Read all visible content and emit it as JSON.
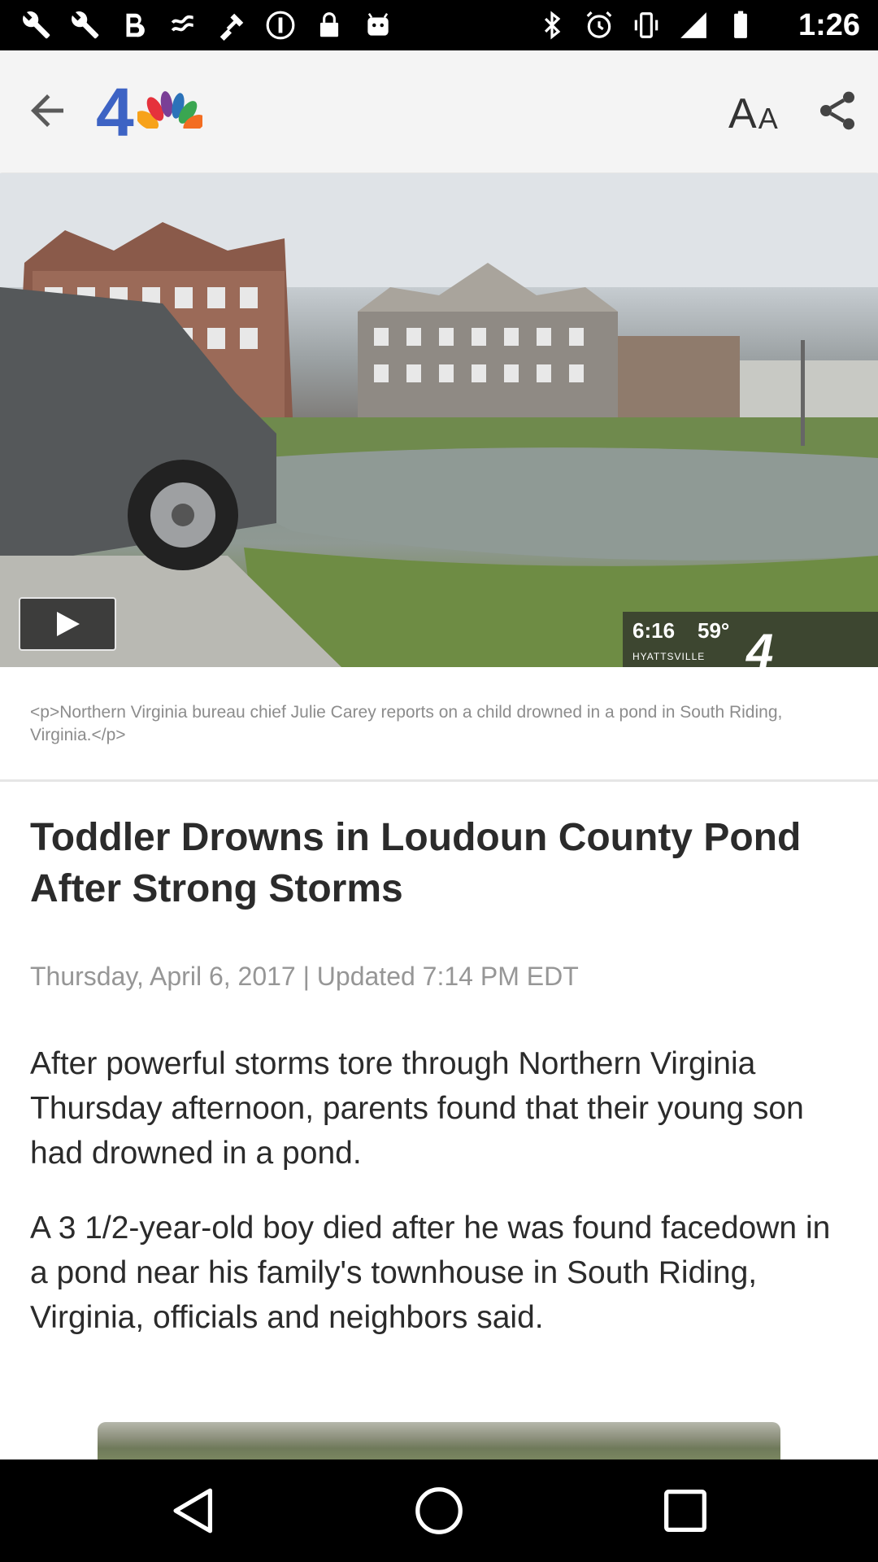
{
  "status_bar": {
    "time": "1:26",
    "left_icons": [
      "wrench-icon",
      "bold-b-icon",
      "swipe-icon",
      "fake-gps-icon",
      "info-icon",
      "lock-icon",
      "android-icon"
    ],
    "right_icons": [
      "bluetooth-icon",
      "alarm-icon",
      "vibrate-icon",
      "signal-icon",
      "battery-icon"
    ]
  },
  "app_bar": {
    "logo_number": "4",
    "text_size_label_big": "A",
    "text_size_label_small": "A"
  },
  "hero": {
    "overlay_time": "6:16",
    "overlay_temp": "59°",
    "overlay_location": "HYATTSVILLE",
    "overlay_channel": "4"
  },
  "caption": "<p>Northern Virginia bureau chief Julie Carey reports on a child drowned in a pond in South Riding, Virginia.</p>",
  "article": {
    "headline": "Toddler Drowns in Loudoun County Pond After Strong Storms",
    "dateline": "Thursday, April 6, 2017 | Updated 7:14 PM EDT",
    "paragraphs": [
      "After powerful storms tore through Northern Virginia Thursday afternoon, parents found that their young son had drowned in a pond.",
      "A 3 1/2-year-old boy died after he was found facedown in a pond near his family's townhouse in South Riding, Virginia, officials and neighbors said."
    ]
  },
  "colors": {
    "logo_blue": "#3d63c4",
    "peacock": [
      "#f7a21b",
      "#e5323c",
      "#7a3f96",
      "#2b72b9",
      "#3aa651",
      "#f36d21"
    ]
  }
}
